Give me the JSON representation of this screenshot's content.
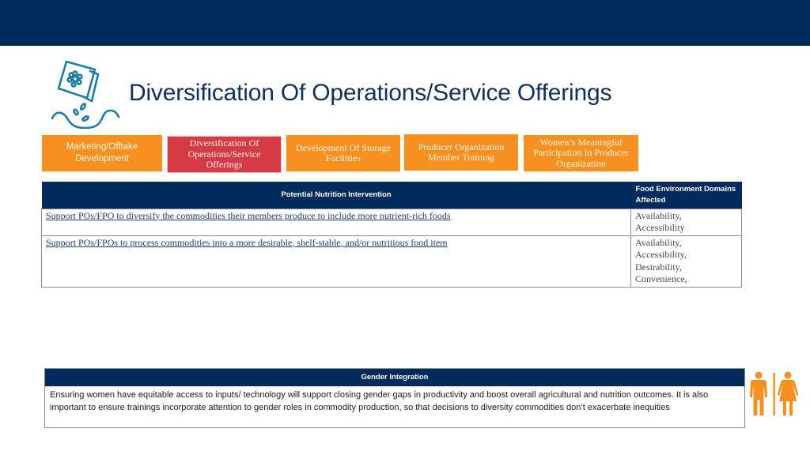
{
  "header": {
    "title": "Diversification Of Operations/Service Offerings",
    "icon": "seed-packet-planting-icon"
  },
  "nav_tabs": [
    {
      "label": "Marketing/Offtake Development",
      "active": false
    },
    {
      "label": "Diversification Of Operations/Service Offerings",
      "active": true
    },
    {
      "label": "Development Of Storage Facilities",
      "active": false
    },
    {
      "label": "Producer Organization Member Training",
      "active": false
    },
    {
      "label": "Women’s Meaningful Participation In Producer Organization",
      "active": false
    }
  ],
  "colors": {
    "primary_navy": "#002b5c",
    "tab_orange": "#f7901e",
    "tab_active_red": "#d63a45"
  },
  "nutrition_table": {
    "headers": [
      "Potential Nutrition Intervention",
      "Food Environment Domains Affected"
    ],
    "rows": [
      {
        "intervention": "Support POs/FPO to diversify the commodities their members produce to include more nutrient-rich foods",
        "domains": [
          "Availability,",
          "Accessibility"
        ]
      },
      {
        "intervention": "Support POs/FPOs to process commodities into a more desirable, shelf-stable, and/or nutritious food item",
        "domains": [
          "Availability,",
          "Accessibility,",
          "Desirability,",
          "Convenience,"
        ]
      }
    ]
  },
  "gender_integration": {
    "heading": "Gender Integration",
    "text": "Ensuring women have equitable access to inputs/ technology will support closing gender gaps in productivity and boost overall agricultural and nutrition outcomes. It is also important to ensure trainings incorporate attention to gender roles in commodity production, so that decisions to diversity commodities don’t exacerbate inequities",
    "icon": "man-woman-icon"
  }
}
